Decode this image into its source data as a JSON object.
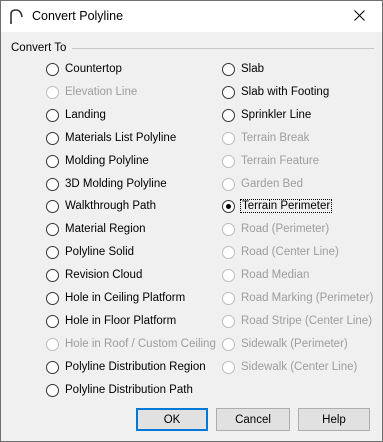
{
  "window": {
    "title": "Convert Polyline",
    "icon": "polyline-app-icon"
  },
  "group": {
    "label": "Convert To"
  },
  "left_options": [
    {
      "label": "Countertop",
      "enabled": true,
      "checked": false
    },
    {
      "label": "Elevation Line",
      "enabled": false,
      "checked": false
    },
    {
      "label": "Landing",
      "enabled": true,
      "checked": false
    },
    {
      "label": "Materials List Polyline",
      "enabled": true,
      "checked": false
    },
    {
      "label": "Molding Polyline",
      "enabled": true,
      "checked": false
    },
    {
      "label": "3D Molding Polyline",
      "enabled": true,
      "checked": false
    },
    {
      "label": "Walkthrough Path",
      "enabled": true,
      "checked": false
    },
    {
      "label": "Material Region",
      "enabled": true,
      "checked": false
    },
    {
      "label": "Polyline Solid",
      "enabled": true,
      "checked": false
    },
    {
      "label": "Revision Cloud",
      "enabled": true,
      "checked": false
    },
    {
      "label": "Hole in Ceiling Platform",
      "enabled": true,
      "checked": false
    },
    {
      "label": "Hole in Floor Platform",
      "enabled": true,
      "checked": false
    },
    {
      "label": "Hole in Roof / Custom Ceiling",
      "enabled": false,
      "checked": false
    },
    {
      "label": "Polyline Distribution Region",
      "enabled": true,
      "checked": false
    },
    {
      "label": "Polyline Distribution Path",
      "enabled": true,
      "checked": false
    }
  ],
  "right_options": [
    {
      "label": "Slab",
      "enabled": true,
      "checked": false
    },
    {
      "label": "Slab with Footing",
      "enabled": true,
      "checked": false
    },
    {
      "label": "Sprinkler Line",
      "enabled": true,
      "checked": false
    },
    {
      "label": "Terrain Break",
      "enabled": false,
      "checked": false
    },
    {
      "label": "Terrain Feature",
      "enabled": false,
      "checked": false
    },
    {
      "label": "Garden Bed",
      "enabled": false,
      "checked": false
    },
    {
      "label": "Terrain Perimeter",
      "enabled": true,
      "checked": true
    },
    {
      "label": "Road (Perimeter)",
      "enabled": false,
      "checked": false
    },
    {
      "label": "Road (Center Line)",
      "enabled": false,
      "checked": false
    },
    {
      "label": "Road Median",
      "enabled": false,
      "checked": false
    },
    {
      "label": "Road Marking (Perimeter)",
      "enabled": false,
      "checked": false
    },
    {
      "label": "Road Stripe (Center Line)",
      "enabled": false,
      "checked": false
    },
    {
      "label": "Sidewalk (Perimeter)",
      "enabled": false,
      "checked": false
    },
    {
      "label": "Sidewalk (Center Line)",
      "enabled": false,
      "checked": false
    }
  ],
  "buttons": {
    "ok": "OK",
    "cancel": "Cancel",
    "help": "Help"
  },
  "colors": {
    "accent": "#0078d7",
    "disabled_text": "#9d9d9d",
    "dialog_bg": "#f0f0f0"
  }
}
